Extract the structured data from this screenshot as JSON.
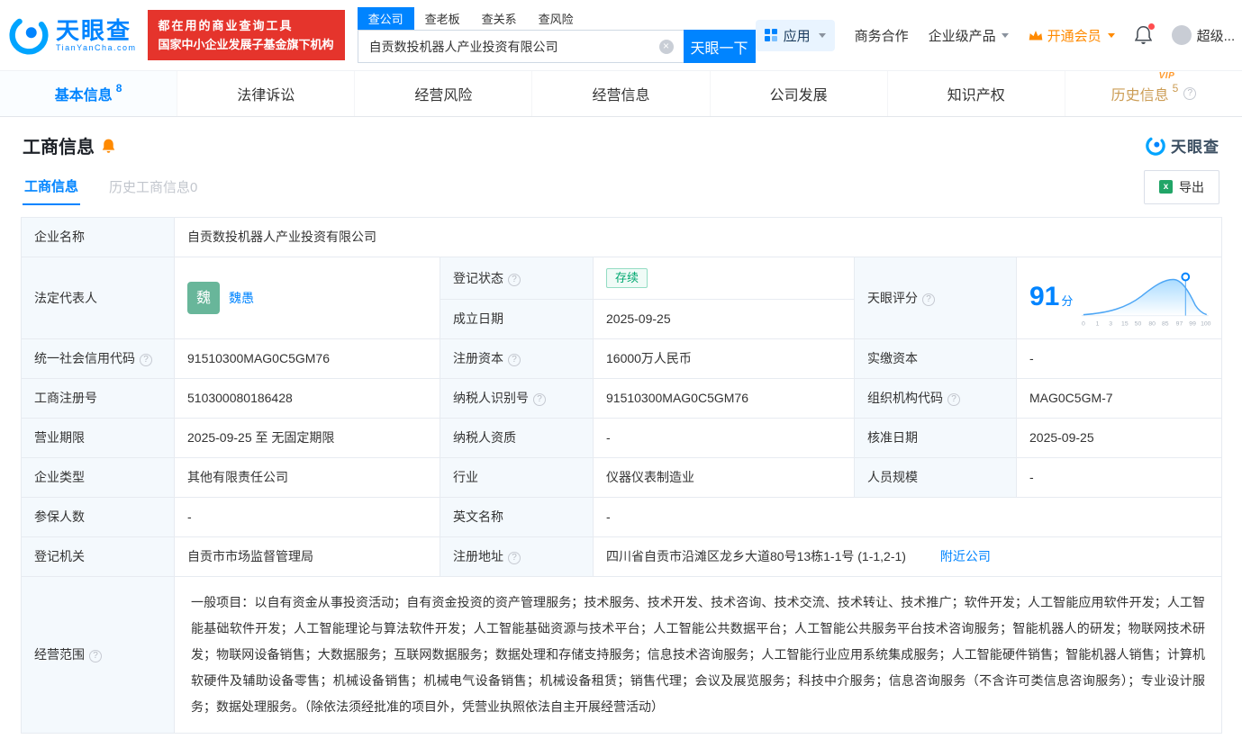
{
  "colors": {
    "brand_blue": "#0084ff",
    "vip_orange": "#ff8a00",
    "slogan_red": "#e5342c",
    "status_green": "#00a870",
    "history_gold": "#cb9c54",
    "avatar_green": "#68b69a"
  },
  "header": {
    "logo_text": "天眼查",
    "logo_sub": "TianYanCha.com",
    "slogan_line1": "都在用的商业查询工具",
    "slogan_line2": "国家中小企业发展子基金旗下机构",
    "search_tabs": [
      {
        "label": "查公司"
      },
      {
        "label": "查老板"
      },
      {
        "label": "查关系"
      },
      {
        "label": "查风险"
      }
    ],
    "search_value": "自贡数投机器人产业投资有限公司",
    "search_button": "天眼一下",
    "nav_apps": "应用",
    "nav_business": "商务合作",
    "nav_enterprise": "企业级产品",
    "nav_vip": "开通会员",
    "nav_user": "超级..."
  },
  "tabs": [
    {
      "label": "基本信息",
      "count": "8"
    },
    {
      "label": "法律诉讼",
      "count": ""
    },
    {
      "label": "经营风险",
      "count": ""
    },
    {
      "label": "经营信息",
      "count": ""
    },
    {
      "label": "公司发展",
      "count": ""
    },
    {
      "label": "知识产权",
      "count": ""
    },
    {
      "label": "历史信息",
      "count": "5",
      "vip_tag": "VIP"
    }
  ],
  "section": {
    "title": "工商信息",
    "watermark": "天眼查",
    "subtab_current": "工商信息",
    "subtab_history": "历史工商信息0",
    "export_label": "导出"
  },
  "info": {
    "labels": {
      "name": "企业名称",
      "legal_rep": "法定代表人",
      "reg_status": "登记状态",
      "establish_date": "成立日期",
      "score": "天眼评分",
      "credit_code": "统一社会信用代码",
      "reg_capital": "注册资本",
      "paid_capital": "实缴资本",
      "reg_number": "工商注册号",
      "taxpayer_id": "纳税人识别号",
      "org_code": "组织机构代码",
      "business_term": "营业期限",
      "taxpayer_quality": "纳税人资质",
      "approval_date": "核准日期",
      "company_type": "企业类型",
      "industry": "行业",
      "staff_size": "人员规模",
      "insured_count": "参保人数",
      "english_name": "英文名称",
      "reg_authority": "登记机关",
      "reg_address": "注册地址",
      "business_scope": "经营范围"
    },
    "values": {
      "name": "自贡数投机器人产业投资有限公司",
      "legal_rep_avatar": "魏",
      "legal_rep": "魏愚",
      "reg_status": "存续",
      "establish_date": "2025-09-25",
      "score_value": "91",
      "score_unit": "分",
      "credit_code": "91510300MAG0C5GM76",
      "reg_capital": "16000万人民币",
      "paid_capital": "-",
      "reg_number": "510300080186428",
      "taxpayer_id": "91510300MAG0C5GM76",
      "org_code": "MAG0C5GM-7",
      "business_term": "2025-09-25 至 无固定期限",
      "taxpayer_quality": "-",
      "approval_date": "2025-09-25",
      "company_type": "其他有限责任公司",
      "industry": "仪器仪表制造业",
      "staff_size": "-",
      "insured_count": "-",
      "english_name": "-",
      "reg_authority": "自贡市市场监督管理局",
      "reg_address": "四川省自贡市沿滩区龙乡大道80号13栋1-1号 (1-1,2-1)",
      "nearby_link": "附近公司",
      "business_scope": "一般项目：以自有资金从事投资活动；自有资金投资的资产管理服务；技术服务、技术开发、技术咨询、技术交流、技术转让、技术推广；软件开发；人工智能应用软件开发；人工智能基础软件开发；人工智能理论与算法软件开发；人工智能基础资源与技术平台；人工智能公共数据平台；人工智能公共服务平台技术咨询服务；智能机器人的研发；物联网技术研发；物联网设备销售；大数据服务；互联网数据服务；数据处理和存储支持服务；信息技术咨询服务；人工智能行业应用系统集成服务；人工智能硬件销售；智能机器人销售；计算机软硬件及辅助设备零售；机械设备销售；机械电气设备销售；机械设备租赁；销售代理；会议及展览服务；科技中介服务；信息咨询服务（不含许可类信息咨询服务）；专业设计服务；数据处理服务。（除依法须经批准的项目外，凭营业执照依法自主开展经营活动）"
    },
    "score_ticks": [
      "0",
      "1",
      "3",
      "15",
      "50",
      "80",
      "85",
      "97",
      "99",
      "100"
    ]
  }
}
